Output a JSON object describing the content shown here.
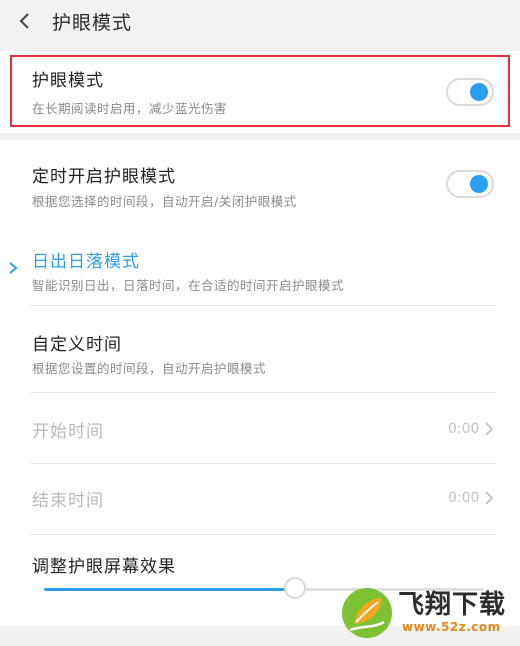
{
  "header": {
    "title": "护眼模式"
  },
  "eye_mode": {
    "title": "护眼模式",
    "subtitle": "在长期阅读时启用，减少蓝光伤害",
    "enabled": true
  },
  "scheduled": {
    "title": "定时开启护眼模式",
    "subtitle": "根据您选择的时间段，自动开启/关闭护眼模式",
    "enabled": true
  },
  "sunrise": {
    "title": "日出日落模式",
    "subtitle": "智能识别日出，日落时间，在合适的时间开启护眼模式",
    "selected": true
  },
  "custom_time": {
    "title": "自定义时间",
    "subtitle": "根据您设置的时间段，自动开启护眼模式"
  },
  "start_time": {
    "label": "开始时间",
    "value": "0:00"
  },
  "end_time": {
    "label": "结束时间",
    "value": "0:00"
  },
  "effect": {
    "title": "调整护眼屏幕效果",
    "level": 0.57
  },
  "watermark": {
    "brand": "飞翔下载",
    "url": "www.52z.com"
  },
  "colors": {
    "accent": "#2a9fed",
    "highlight_box": "#e53238"
  }
}
